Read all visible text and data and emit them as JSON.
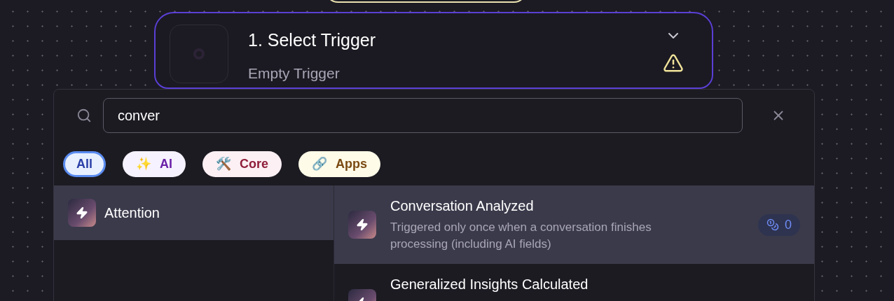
{
  "step": {
    "title": "1. Select Trigger",
    "subtitle": "Empty Trigger",
    "warning": true
  },
  "search": {
    "value": "conver"
  },
  "filters": [
    {
      "label": "All",
      "kind": "all",
      "selected": true
    },
    {
      "label": "AI",
      "emoji": "✨",
      "kind": "ai",
      "selected": false
    },
    {
      "label": "Core",
      "emoji": "🛠️",
      "kind": "core",
      "selected": false
    },
    {
      "label": "Apps",
      "emoji": "🔗",
      "kind": "apps",
      "selected": false
    }
  ],
  "categories": [
    {
      "label": "Attention",
      "selected": true
    }
  ],
  "results": [
    {
      "title": "Conversation Analyzed",
      "description": "Triggered only once when a conversation finishes processing (including AI fields)",
      "count": "0",
      "selected": true
    },
    {
      "title": "Generalized Insights Calculated",
      "selected": false
    }
  ]
}
